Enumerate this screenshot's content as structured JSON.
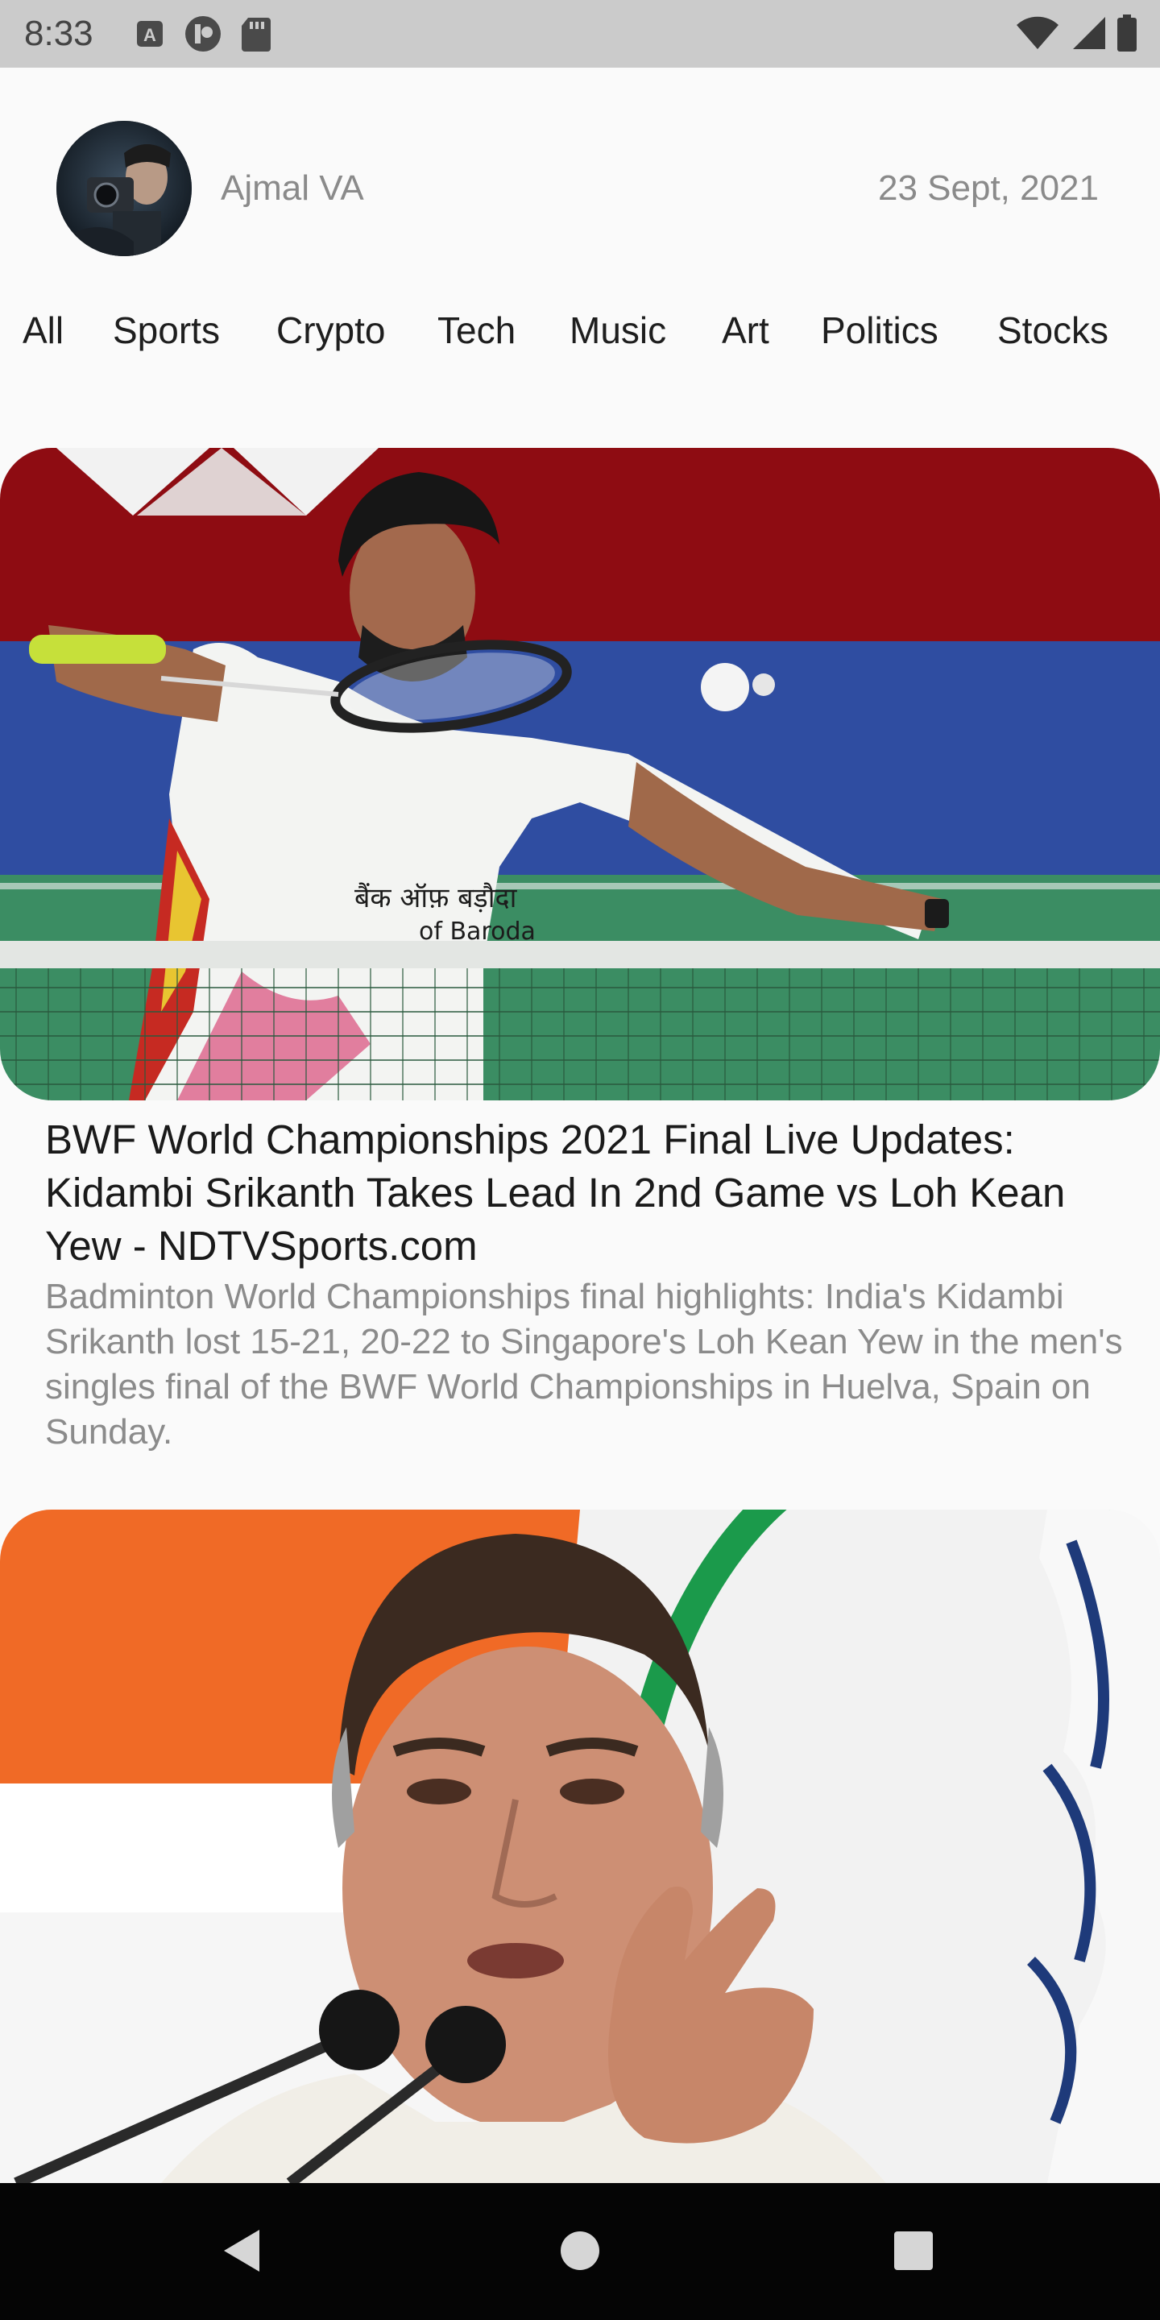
{
  "status_bar": {
    "time": "8:33",
    "left_icons": [
      "keyboard-a-icon",
      "notification-circle-icon",
      "sd-card-icon"
    ],
    "right_icons": [
      "wifi-icon",
      "cell-signal-icon",
      "battery-icon"
    ]
  },
  "header": {
    "user_name": "Ajmal VA",
    "date": "23 Sept, 2021"
  },
  "categories": [
    "All",
    "Sports",
    "Crypto",
    "Tech",
    "Music",
    "Art",
    "Politics",
    "Stocks"
  ],
  "articles": [
    {
      "title": "BWF World Championships 2021 Final Live Updates: Kidambi Srikanth Takes Lead In 2nd Game vs Loh Kean Yew - NDTVSports.com",
      "description": "Badminton World Championships final highlights: India's Kidambi Srikanth lost 15-21, 20-22 to Singapore's Loh Kean Yew in the men's singles final of the BWF World Championships in Huelva, Spain on Sunday.",
      "jersey_text": "बैंक ऑफ़ बड़ौदा",
      "jersey_sub": "of Baroda"
    },
    {
      "title": "",
      "description": ""
    }
  ],
  "nav_bar": {
    "icons": [
      "back-triangle-icon",
      "home-circle-icon",
      "recents-square-icon"
    ]
  },
  "colors": {
    "background": "#fafafa",
    "status_bar": "#cbcbcb",
    "nav_bar": "#050505",
    "title_text": "#1a1a1a",
    "muted_text": "#8b8b8b"
  }
}
